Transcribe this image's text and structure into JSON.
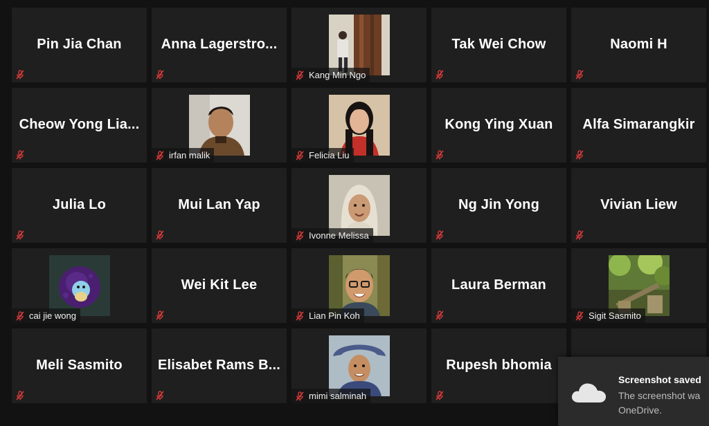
{
  "participants": [
    {
      "name": "Pin Jia Chan",
      "video": false
    },
    {
      "name": "Anna  Lagerstro...",
      "video": false
    },
    {
      "name": "Kang Min Ngo",
      "video": true,
      "photo": "forest-tree-photo"
    },
    {
      "name": "Tak Wei Chow",
      "video": false
    },
    {
      "name": "Naomi H",
      "video": false
    },
    {
      "name": "Cheow  Yong  Lia...",
      "video": false
    },
    {
      "name": "irfan malik",
      "video": true,
      "photo": "man-portrait-photo"
    },
    {
      "name": "Felicia Liu",
      "video": true,
      "photo": "woman-portrait-photo"
    },
    {
      "name": "Kong Ying Xuan",
      "video": false
    },
    {
      "name": "Alfa Simarangkir",
      "video": false
    },
    {
      "name": "Julia Lo",
      "video": false
    },
    {
      "name": "Mui Lan Yap",
      "video": false
    },
    {
      "name": "Ivonne Melissa",
      "video": true,
      "photo": "hijab-portrait-photo"
    },
    {
      "name": "Ng Jin Yong",
      "video": false
    },
    {
      "name": "Vivian Liew",
      "video": false
    },
    {
      "name": "cai jie wong",
      "video": true,
      "photo": "cartoon-avatar-photo"
    },
    {
      "name": "Wei Kit Lee",
      "video": false
    },
    {
      "name": "Lian Pin Koh",
      "video": true,
      "photo": "man-glasses-photo"
    },
    {
      "name": "Laura Berman",
      "video": false
    },
    {
      "name": "Sigit Sasmito",
      "video": true,
      "photo": "forest-scene-photo"
    },
    {
      "name": "Meli Sasmito",
      "video": false
    },
    {
      "name": "Elisabet  Rams  B...",
      "video": false
    },
    {
      "name": "mimi salminah",
      "video": true,
      "photo": "woman-hat-photo"
    },
    {
      "name": "Rupesh bhomia",
      "video": false
    },
    {
      "name": "",
      "video": false,
      "hidden_by_toast": true
    }
  ],
  "toast": {
    "title": "Screenshot saved",
    "line1": "The screenshot wa",
    "line2": "OneDrive.",
    "icon": "onedrive-cloud-icon"
  },
  "colors": {
    "background": "#121212",
    "tile": "#1f1f1f",
    "muted": "#d83b3b"
  }
}
